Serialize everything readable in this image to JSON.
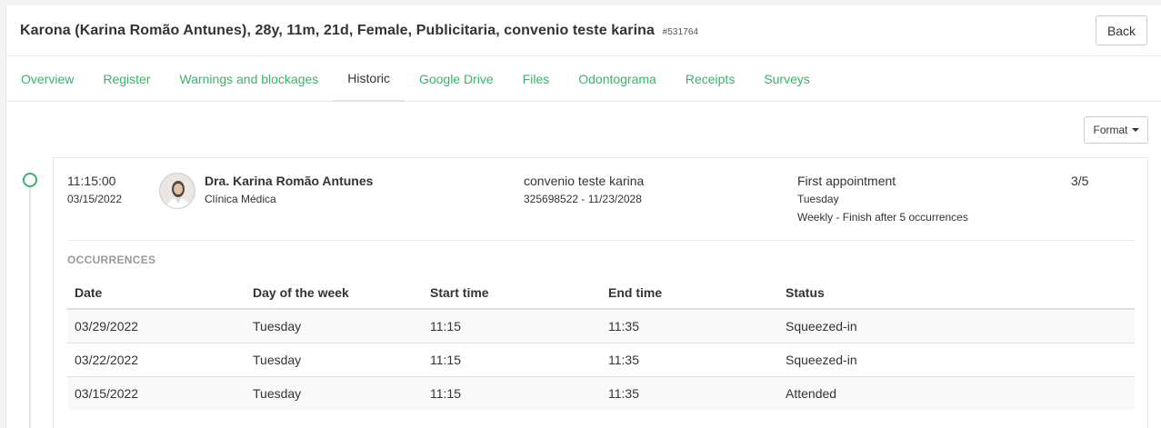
{
  "header": {
    "title": "Karona (Karina Romão Antunes), 28y, 11m, 21d, Female, Publicitaria, convenio teste karina",
    "patient_id": "#531764",
    "back_label": "Back"
  },
  "tabs": [
    {
      "label": "Overview"
    },
    {
      "label": "Register"
    },
    {
      "label": "Warnings and blockages"
    },
    {
      "label": "Historic",
      "active": true
    },
    {
      "label": "Google Drive"
    },
    {
      "label": "Files"
    },
    {
      "label": "Odontograma"
    },
    {
      "label": "Receipts"
    },
    {
      "label": "Surveys"
    }
  ],
  "format_label": "Format",
  "entry": {
    "time": "11:15:00",
    "date": "03/15/2022",
    "doctor_name": "Dra. Karina Romão Antunes",
    "specialty": "Clínica Médica",
    "insurance_name": "convenio teste karina",
    "insurance_details": "325698522 - 11/23/2028",
    "appointment_type": "First appointment",
    "weekday": "Tuesday",
    "recurrence": "Weekly - Finish after 5 occurrences",
    "progress": "3/5",
    "occurrences_label": "OCCURRENCES",
    "columns": [
      "Date",
      "Day of the week",
      "Start time",
      "End time",
      "Status"
    ],
    "rows": [
      [
        "03/29/2022",
        "Tuesday",
        "11:15",
        "11:35",
        "Squeezed-in"
      ],
      [
        "03/22/2022",
        "Tuesday",
        "11:15",
        "11:35",
        "Squeezed-in"
      ],
      [
        "03/15/2022",
        "Tuesday",
        "11:15",
        "11:35",
        "Attended"
      ]
    ]
  },
  "colors": {
    "accent": "#35b56a",
    "text": "#333333",
    "muted": "#999999"
  }
}
